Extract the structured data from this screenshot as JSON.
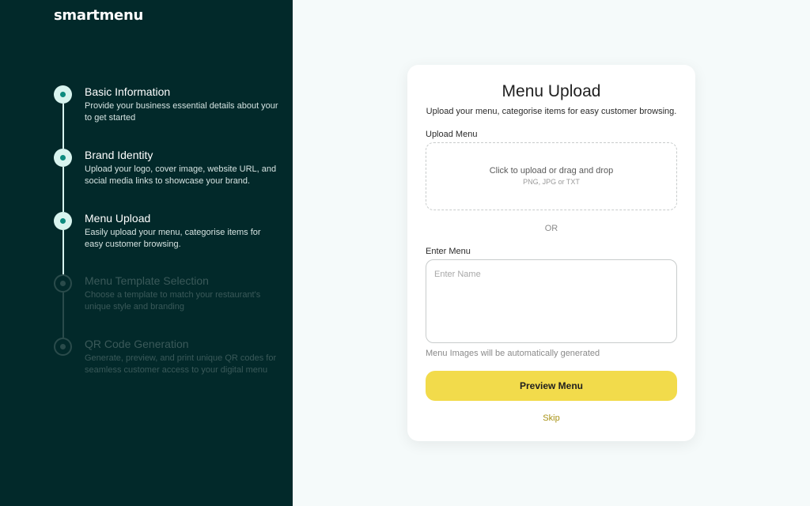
{
  "brand": {
    "name": "smartmenu"
  },
  "steps": [
    {
      "title": "Basic Information",
      "desc": "Provide your business  essential details about your to get started",
      "state": "completed"
    },
    {
      "title": "Brand Identity",
      "desc": "Upload your logo, cover image, website URL, and social media links to showcase your brand.",
      "state": "completed"
    },
    {
      "title": "Menu Upload",
      "desc": "Easily upload your menu, categorise items for easy customer browsing.",
      "state": "current"
    },
    {
      "title": "Menu Template Selection",
      "desc": "Choose a template to match your restaurant's unique style and branding",
      "state": "pending"
    },
    {
      "title": "QR Code Generation",
      "desc": "Generate, preview, and print unique QR codes for seamless customer access to your digital menu",
      "state": "pending"
    }
  ],
  "form": {
    "title": "Menu Upload",
    "subtitle": "Upload your menu, categorise items for easy customer browsing.",
    "upload_label": "Upload Menu",
    "dropzone_text": "Click to upload or drag and drop",
    "dropzone_formats": "PNG, JPG or TXT",
    "or_text": "OR",
    "enter_label": "Enter Menu",
    "enter_placeholder": "Enter Name",
    "enter_value": "",
    "hint": "Menu Images will be automatically generated",
    "preview_button": "Preview Menu",
    "skip_link": "Skip"
  },
  "colors": {
    "sidebar_bg": "#02292a",
    "accent_teal": "#0d8b7f",
    "button_yellow": "#f2db4b",
    "skip_link": "#a89214"
  }
}
